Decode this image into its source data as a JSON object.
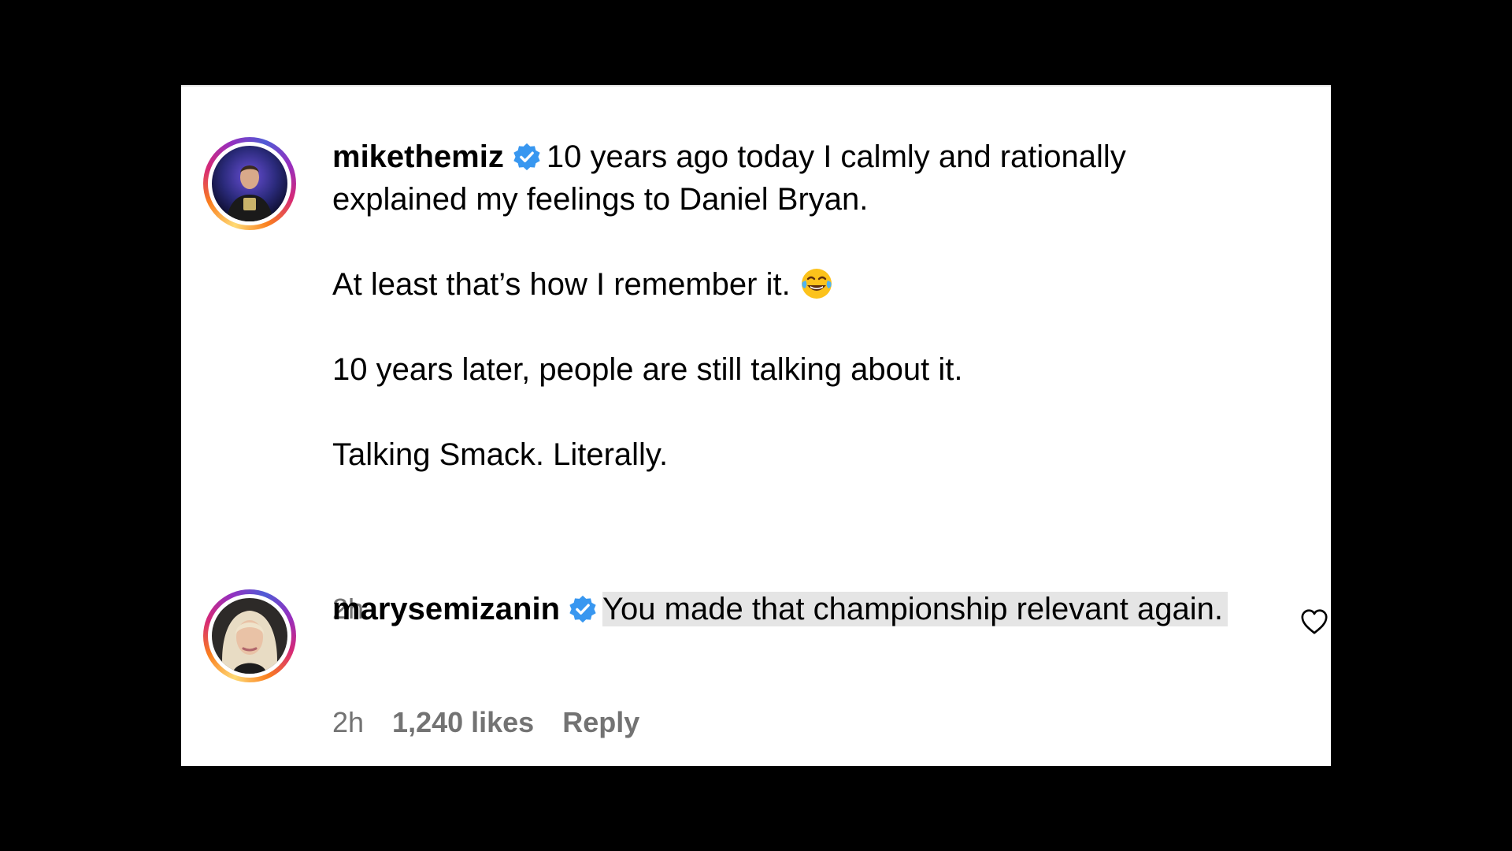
{
  "comments": [
    {
      "username": "mikethemiz",
      "verified": true,
      "first_line": "10 years ago today I calmly and rationally explained my feelings to Daniel Bryan.",
      "paragraph_2": "At least that’s how I remember it.",
      "paragraph_2_emoji": "face-with-tears-of-joy-icon",
      "paragraph_3": "10 years later, people are still talking about it.",
      "paragraph_4": "Talking Smack. Literally.",
      "time": "2h"
    },
    {
      "username": "marysemizanin",
      "verified": true,
      "text": "You made that championship relevant again.",
      "time": "2h",
      "likes": "1,240 likes",
      "reply_label": "Reply"
    }
  ],
  "colors": {
    "verified_blue": "#3897f0",
    "meta_gray": "#737373",
    "highlight_gray": "#e5e5e5"
  }
}
